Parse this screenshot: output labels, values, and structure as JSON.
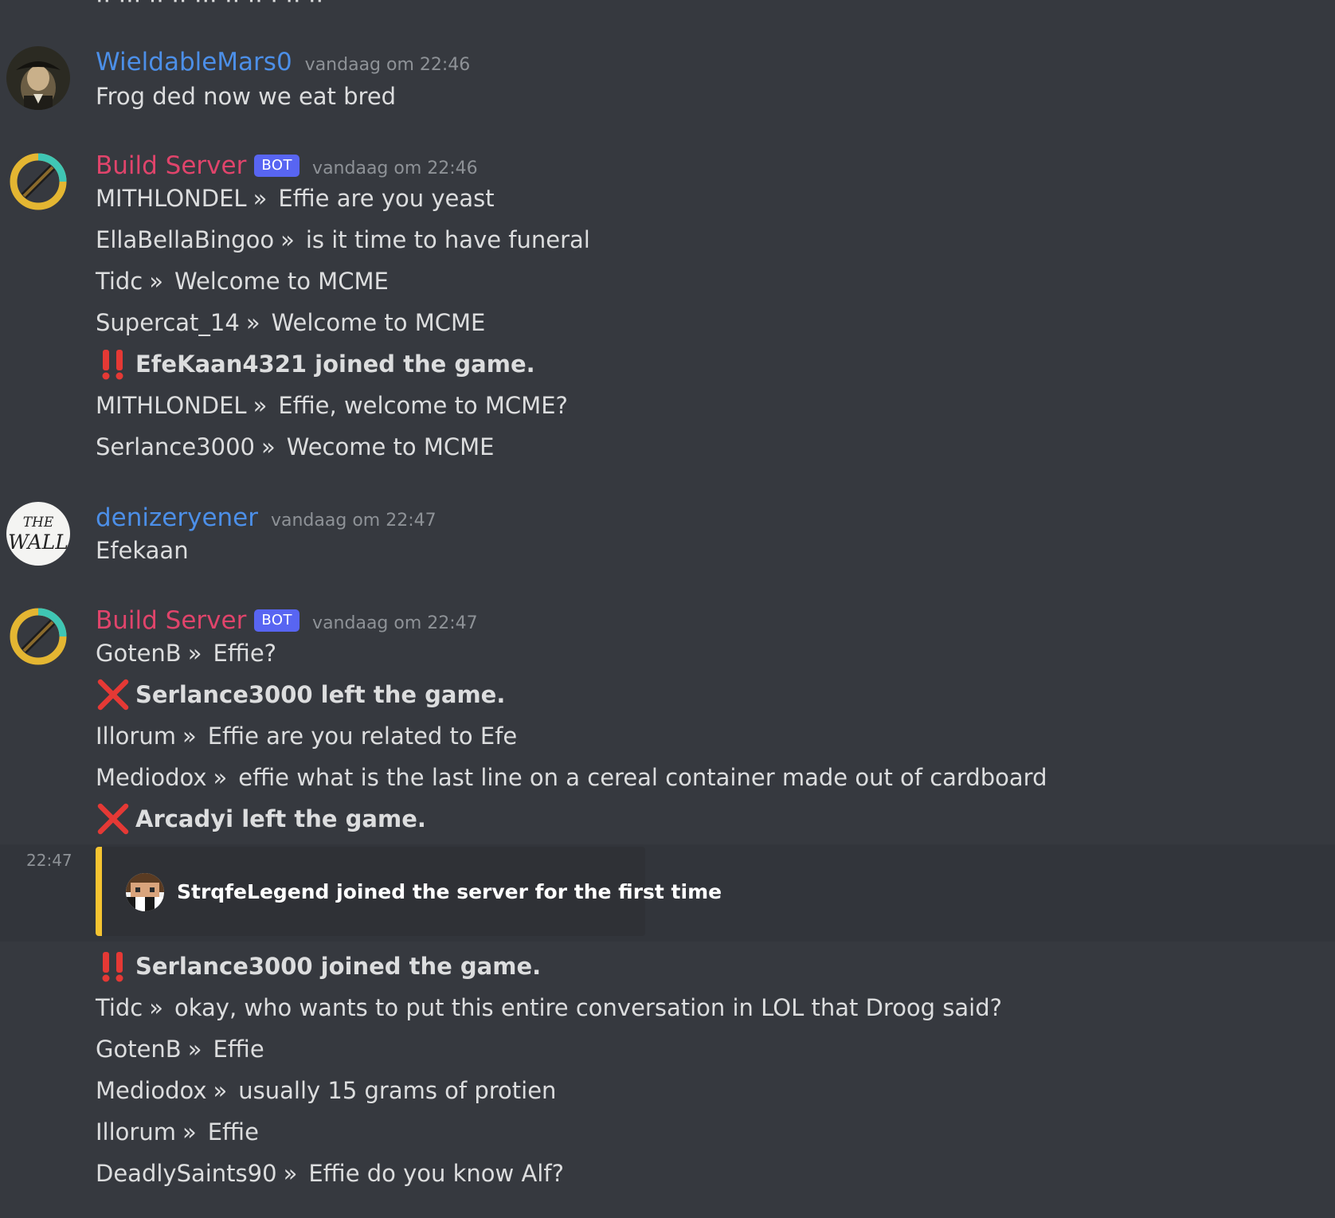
{
  "cutoff_text": "·· ··· ·· ·· ··· ·· ·· · ·· ··",
  "groups": [
    {
      "author": "WieldableMars0",
      "author_color": "#4c8fe8",
      "is_bot": false,
      "timestamp": "vandaag om 22:46",
      "avatar": "tricorn-portrait-avatar",
      "messages": [
        {
          "type": "text",
          "text": "Frog ded now we eat bred"
        }
      ]
    },
    {
      "author": "Build Server",
      "author_color": "#e0446b",
      "is_bot": true,
      "bot_label": "BOT",
      "timestamp": "vandaag om 22:46",
      "avatar": "pickaxe-ring-avatar",
      "messages": [
        {
          "type": "chat",
          "player": "MITHLONDEL",
          "sep": "»",
          "text": "Effie are you yeast"
        },
        {
          "type": "chat",
          "player": "EllaBellaBingoo",
          "sep": "»",
          "text": "is it time to have funeral"
        },
        {
          "type": "chat",
          "player": "Tidc",
          "sep": "»",
          "text": "Welcome to MCME"
        },
        {
          "type": "chat",
          "player": "Supercat_14",
          "sep": "»",
          "text": "Welcome to MCME"
        },
        {
          "type": "event",
          "icon": "double-exclamation-icon",
          "text": "EfeKaan4321 joined the game."
        },
        {
          "type": "chat",
          "player": "MITHLONDEL",
          "sep": "»",
          "text": "Effie, welcome to MCME?"
        },
        {
          "type": "chat",
          "player": "Serlance3000",
          "sep": "»",
          "text": "Wecome to MCME"
        }
      ]
    },
    {
      "author": "denizeryener",
      "author_color": "#4c8fe8",
      "is_bot": false,
      "timestamp": "vandaag om 22:47",
      "avatar": "the-wall-avatar",
      "avatar_text": "THE WALL",
      "messages": [
        {
          "type": "text",
          "text": "Efekaan"
        }
      ]
    },
    {
      "author": "Build Server",
      "author_color": "#e0446b",
      "is_bot": true,
      "bot_label": "BOT",
      "timestamp": "vandaag om 22:47",
      "avatar": "pickaxe-ring-avatar",
      "messages": [
        {
          "type": "chat",
          "player": "GotenB",
          "sep": "»",
          "text": "Effie?"
        },
        {
          "type": "event",
          "icon": "red-x-icon",
          "text": "Serlance3000 left the game."
        },
        {
          "type": "chat",
          "player": "Illorum",
          "sep": "»",
          "text": "Effie are you related to Efe"
        },
        {
          "type": "chat",
          "player": "Mediodox",
          "sep": "»",
          "text": "effie what is the last line on a cereal container made out of cardboard"
        },
        {
          "type": "event",
          "icon": "red-x-icon",
          "text": "Arcadyi left the game."
        }
      ]
    }
  ],
  "embed_message": {
    "hover_time": "22:47",
    "accent_color": "#f5c431",
    "avatar": "pixel-skin-avatar",
    "text": "StrqfeLegend joined the server for the first time"
  },
  "trailing_messages": [
    {
      "type": "event",
      "icon": "double-exclamation-icon",
      "text": "Serlance3000 joined the game."
    },
    {
      "type": "chat",
      "player": "Tidc",
      "sep": "»",
      "text": "okay, who wants to put this entire conversation in LOL that Droog said?"
    },
    {
      "type": "chat",
      "player": "GotenB",
      "sep": "»",
      "text": "Effie"
    },
    {
      "type": "chat",
      "player": "Mediodox",
      "sep": "»",
      "text": "usually 15 grams of protien"
    },
    {
      "type": "chat",
      "player": "Illorum",
      "sep": "»",
      "text": "Effie"
    },
    {
      "type": "chat",
      "player": "DeadlySaints90",
      "sep": "»",
      "text": "Effie do you know Alf?"
    }
  ],
  "colors": {
    "background": "#36393f",
    "text": "#dcddde",
    "muted": "#8e9297",
    "bot_tag": "#5865f2",
    "event_red": "#e53935"
  }
}
